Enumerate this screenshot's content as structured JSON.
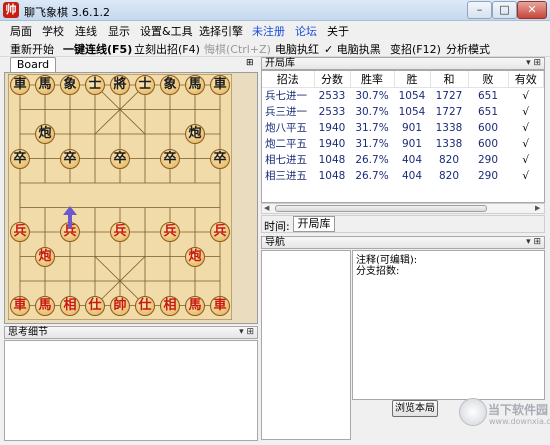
{
  "window": {
    "title": "聊飞象棋 3.6.1.2",
    "icon_char": "帅"
  },
  "window_buttons": {
    "minimize": "–",
    "maximize": "□",
    "close": "✕"
  },
  "menubar": [
    "局面",
    "学校",
    "连线",
    "显示",
    "设置&工具",
    "选择引擎",
    "未注册",
    "论坛",
    "关于"
  ],
  "menu_colors": {
    "未注册": "#1a4fd6",
    "论坛": "#1a4fd6"
  },
  "toolbar": [
    {
      "label": "重新开始",
      "state": "normal"
    },
    {
      "label": "一键连线(F5)",
      "state": "bold"
    },
    {
      "label": "立刻出招(F4)",
      "state": "normal"
    },
    {
      "label": "悔棋(Ctrl+Z)",
      "state": "disabled"
    },
    {
      "label": "电脑执红",
      "state": "normal"
    },
    {
      "label": "✓ 电脑执黑",
      "state": "normal"
    },
    {
      "label": "变招(F12)",
      "state": "normal"
    },
    {
      "label": "分析模式",
      "state": "normal"
    }
  ],
  "board_panel": {
    "tab": "Board",
    "pin": "⊞"
  },
  "board": {
    "black_pieces": [
      {
        "char": "車",
        "file": 0,
        "rank": 0
      },
      {
        "char": "馬",
        "file": 1,
        "rank": 0
      },
      {
        "char": "象",
        "file": 2,
        "rank": 0
      },
      {
        "char": "士",
        "file": 3,
        "rank": 0
      },
      {
        "char": "將",
        "file": 4,
        "rank": 0
      },
      {
        "char": "士",
        "file": 5,
        "rank": 0
      },
      {
        "char": "象",
        "file": 6,
        "rank": 0
      },
      {
        "char": "馬",
        "file": 7,
        "rank": 0
      },
      {
        "char": "車",
        "file": 8,
        "rank": 0
      },
      {
        "char": "炮",
        "file": 1,
        "rank": 2
      },
      {
        "char": "炮",
        "file": 7,
        "rank": 2
      },
      {
        "char": "卒",
        "file": 0,
        "rank": 3
      },
      {
        "char": "卒",
        "file": 2,
        "rank": 3
      },
      {
        "char": "卒",
        "file": 4,
        "rank": 3
      },
      {
        "char": "卒",
        "file": 6,
        "rank": 3
      },
      {
        "char": "卒",
        "file": 8,
        "rank": 3
      }
    ],
    "red_pieces": [
      {
        "char": "兵",
        "file": 0,
        "rank": 6
      },
      {
        "char": "兵",
        "file": 2,
        "rank": 6
      },
      {
        "char": "兵",
        "file": 4,
        "rank": 6
      },
      {
        "char": "兵",
        "file": 6,
        "rank": 6
      },
      {
        "char": "兵",
        "file": 8,
        "rank": 6
      },
      {
        "char": "炮",
        "file": 1,
        "rank": 7
      },
      {
        "char": "炮",
        "file": 7,
        "rank": 7
      },
      {
        "char": "車",
        "file": 0,
        "rank": 9
      },
      {
        "char": "馬",
        "file": 1,
        "rank": 9
      },
      {
        "char": "相",
        "file": 2,
        "rank": 9
      },
      {
        "char": "仕",
        "file": 3,
        "rank": 9
      },
      {
        "char": "帥",
        "file": 4,
        "rank": 9
      },
      {
        "char": "仕",
        "file": 5,
        "rank": 9
      },
      {
        "char": "相",
        "file": 6,
        "rank": 9
      },
      {
        "char": "馬",
        "file": 7,
        "rank": 9
      },
      {
        "char": "車",
        "file": 8,
        "rank": 9
      }
    ],
    "arrow_color": "#6a5acd"
  },
  "think_panel": {
    "title": "思考细节",
    "controls": "▾ ⊞"
  },
  "opening_panel": {
    "title": "开局库",
    "controls": "▾ ⊞",
    "columns": [
      "招法",
      "分数",
      "胜率",
      "胜",
      "和",
      "败",
      "有效"
    ],
    "rows": [
      [
        "兵七进一",
        "2533",
        "30.7%",
        "1054",
        "1727",
        "651",
        "√"
      ],
      [
        "兵三进一",
        "2533",
        "30.7%",
        "1054",
        "1727",
        "651",
        "√"
      ],
      [
        "炮八平五",
        "1940",
        "31.7%",
        "901",
        "1338",
        "600",
        "√"
      ],
      [
        "炮二平五",
        "1940",
        "31.7%",
        "901",
        "1338",
        "600",
        "√"
      ],
      [
        "相七进五",
        "1048",
        "26.7%",
        "404",
        "820",
        "290",
        "√"
      ],
      [
        "相三进五",
        "1048",
        "26.7%",
        "404",
        "820",
        "290",
        "√"
      ]
    ]
  },
  "time_bar": {
    "label": "时间:",
    "tab": "开局库"
  },
  "nav_panel": {
    "title": "导航",
    "controls": "▾ ⊞"
  },
  "notes": {
    "line1": "注释(可编辑):",
    "line2": "分支招数:"
  },
  "browse_button": "浏览本局",
  "watermark": {
    "text": "当下软件园",
    "url": "www.downxia.com"
  }
}
